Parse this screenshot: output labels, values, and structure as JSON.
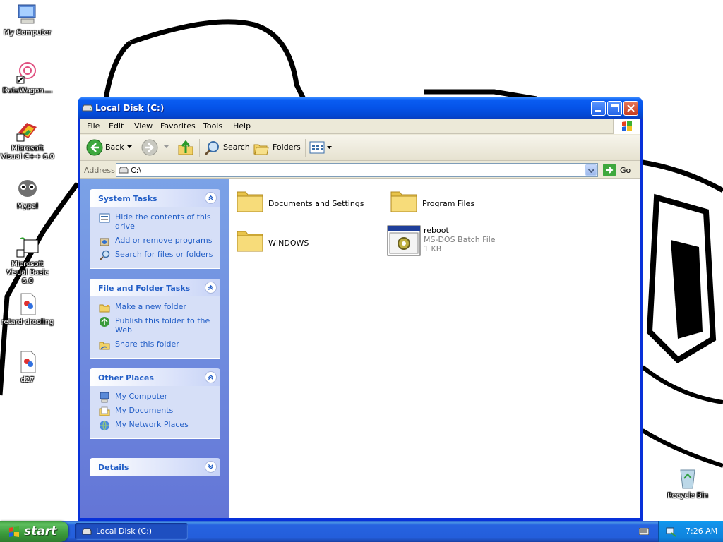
{
  "desktop": {
    "icons": [
      {
        "label": "My Computer",
        "icon": "my-computer-icon"
      },
      {
        "label": "DataWagon....",
        "icon": "datawagon-icon"
      },
      {
        "label": "Microsoft Visual C++ 6.0",
        "icon": "visual-cpp-icon"
      },
      {
        "label": "Mypal",
        "icon": "mypal-icon"
      },
      {
        "label": "Microsoft Visual Basic 6.0",
        "icon": "visual-basic-icon"
      },
      {
        "label": "retard-drooling",
        "icon": "image-file-icon"
      },
      {
        "label": "d27",
        "icon": "image-file-icon"
      },
      {
        "label": "Recycle Bin",
        "icon": "recycle-bin-icon"
      }
    ]
  },
  "window": {
    "title": "Local Disk (C:)",
    "menu": [
      "File",
      "Edit",
      "View",
      "Favorites",
      "Tools",
      "Help"
    ],
    "toolbar": {
      "back": "Back",
      "search": "Search",
      "folders": "Folders"
    },
    "address": {
      "label": "Address",
      "value": "C:\\",
      "go": "Go"
    }
  },
  "taskpane": {
    "system_tasks": {
      "title": "System Tasks",
      "items": [
        "Hide the contents of this drive",
        "Add or remove programs",
        "Search for files or folders"
      ]
    },
    "file_folder_tasks": {
      "title": "File and Folder Tasks",
      "items": [
        "Make a new folder",
        "Publish this folder to the Web",
        "Share this folder"
      ]
    },
    "other_places": {
      "title": "Other Places",
      "items": [
        "My Computer",
        "My Documents",
        "My Network Places"
      ]
    },
    "details": {
      "title": "Details"
    }
  },
  "files": [
    {
      "name": "Documents and Settings",
      "type": "folder"
    },
    {
      "name": "Program Files",
      "type": "folder"
    },
    {
      "name": "WINDOWS",
      "type": "folder"
    },
    {
      "name": "reboot",
      "type": "batch",
      "desc": "MS-DOS Batch File",
      "size": "1 KB"
    }
  ],
  "taskbar": {
    "start": "start",
    "items": [
      "Local Disk (C:)"
    ],
    "clock": "7:26 AM"
  },
  "colors": {
    "titlebar": "#0553e8",
    "taskpane": "#6f8de0",
    "link": "#215dc6",
    "start": "#3b9a3b"
  }
}
